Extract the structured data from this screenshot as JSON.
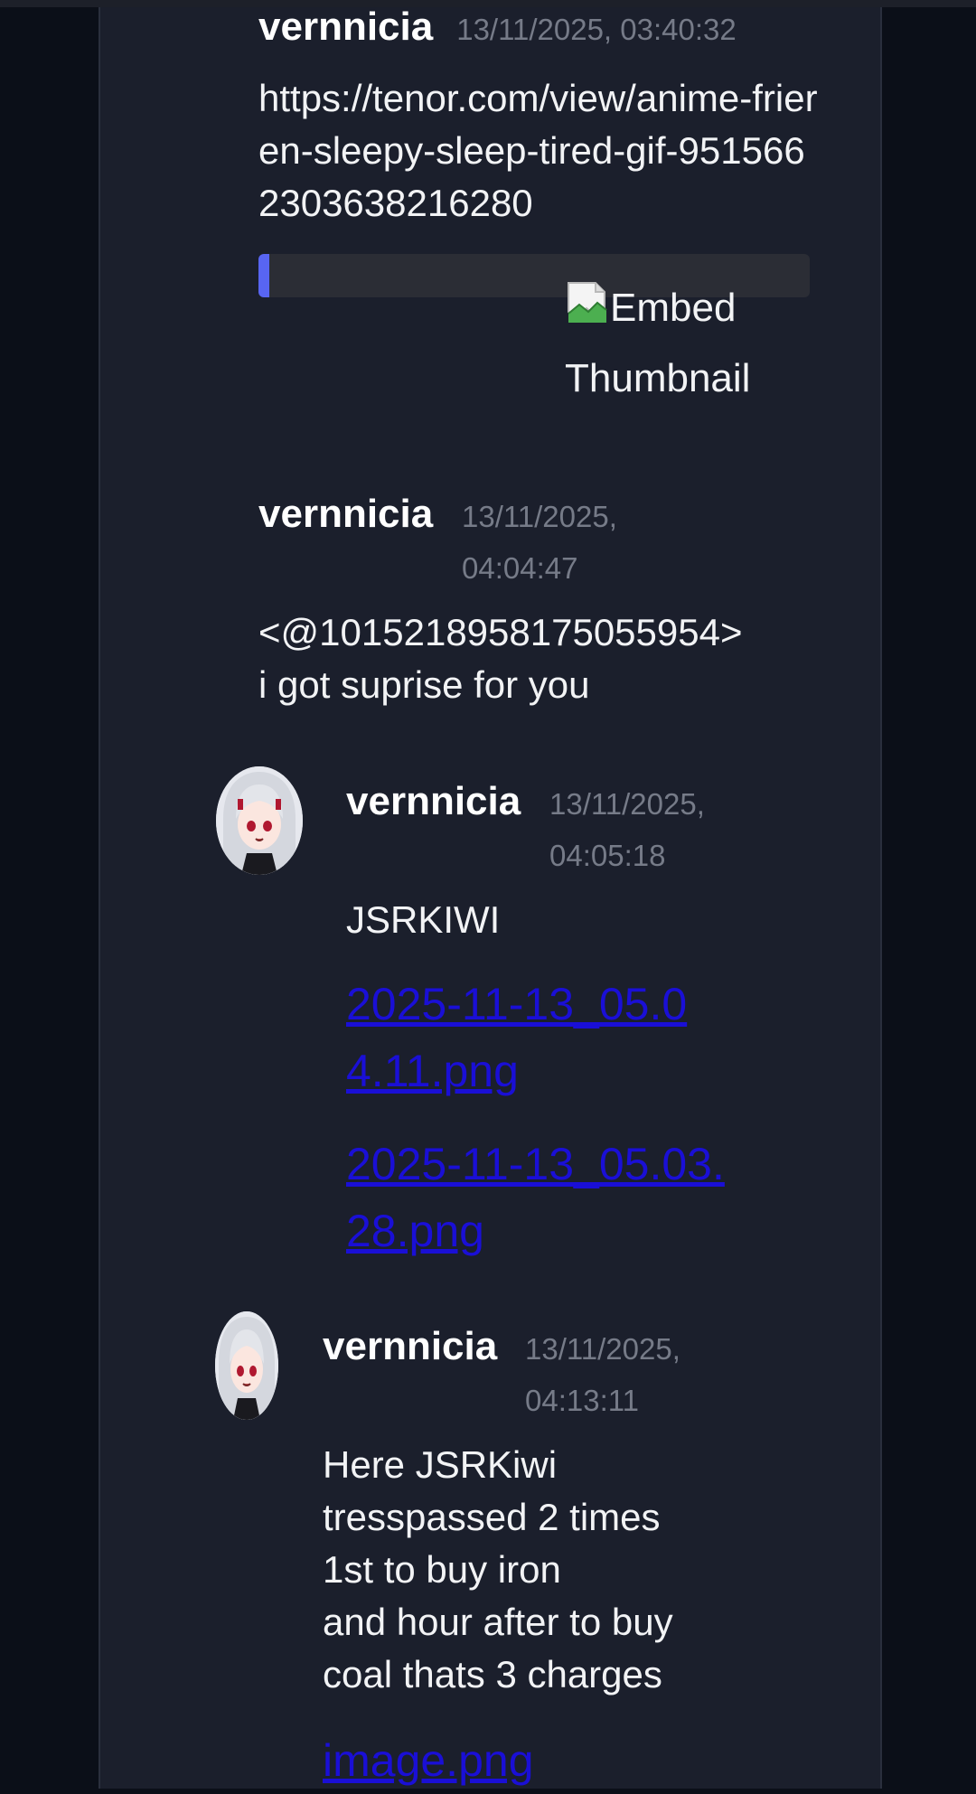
{
  "messages": [
    {
      "username": "vernnicia",
      "timestamp": "13/11/2025, 03:40:32",
      "text": "https://tenor.com/view/anime-frieren-sleepy-sleep-tired-gif-9515662303638216280",
      "embed": {
        "thumbnail_alt": "Embed Thumbnail",
        "accent_color": "#5865f2"
      }
    },
    {
      "username": "vernnicia",
      "timestamp_date": "13/11/2025,",
      "timestamp_time": "04:04:47",
      "text": "<@1015218958175055954>\ni got suprise for you"
    },
    {
      "username": "vernnicia",
      "timestamp_date": "13/11/2025,",
      "timestamp_time": "04:05:18",
      "text": "JSRKIWI",
      "attachments": [
        {
          "name": "2025-11-13_05.04.11.png"
        },
        {
          "name": "2025-11-13_05.03.28.png"
        }
      ]
    },
    {
      "username": "vernnicia",
      "timestamp_date": "13/11/2025,",
      "timestamp_time": "04:13:11",
      "text": "Here JSRKiwi\ntresspassed 2 times\n1st to buy iron\nand hour after to buy\ncoal thats 3 charges",
      "attachments": [
        {
          "name": "image.png"
        }
      ]
    }
  ],
  "colors": {
    "background": "#0b0f18",
    "panel": "#1b1f2c",
    "username": "#ffffff",
    "timestamp": "#767b88",
    "link": "#1a0fd6"
  },
  "icons": [
    "broken-image-icon",
    "avatar-icon"
  ]
}
